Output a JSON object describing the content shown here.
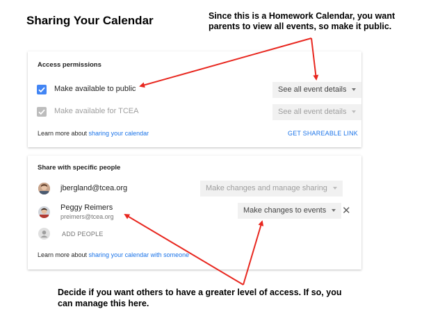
{
  "title": "Sharing Your Calendar",
  "callout_top": "Since this is a Homework Calendar, you want parents to view all events, so make it public.",
  "callout_bottom": "Decide if you want others to have a greater level of access. If so, you can manage this here.",
  "access": {
    "heading": "Access permissions",
    "public_label": "Make available to public",
    "public_dropdown": "See all event details",
    "org_label": "Make available for TCEA",
    "org_dropdown": "See all event details",
    "learn_prefix": "Learn more about ",
    "learn_link": "sharing your calendar",
    "shareable_link": "GET SHAREABLE LINK"
  },
  "share": {
    "heading": "Share with specific people",
    "people": [
      {
        "email": "jbergland@tcea.org",
        "permission": "Make changes and manage sharing"
      },
      {
        "name": "Peggy Reimers",
        "email": "preimers@tcea.org",
        "permission": "Make changes to events"
      }
    ],
    "add_people": "ADD PEOPLE",
    "learn_prefix": "Learn more about ",
    "learn_link": "sharing your calendar with someone",
    "remove_glyph": "✕"
  },
  "colors": {
    "accent": "#4285f4",
    "annotation": "#e8271f",
    "link": "#1a73e8"
  }
}
